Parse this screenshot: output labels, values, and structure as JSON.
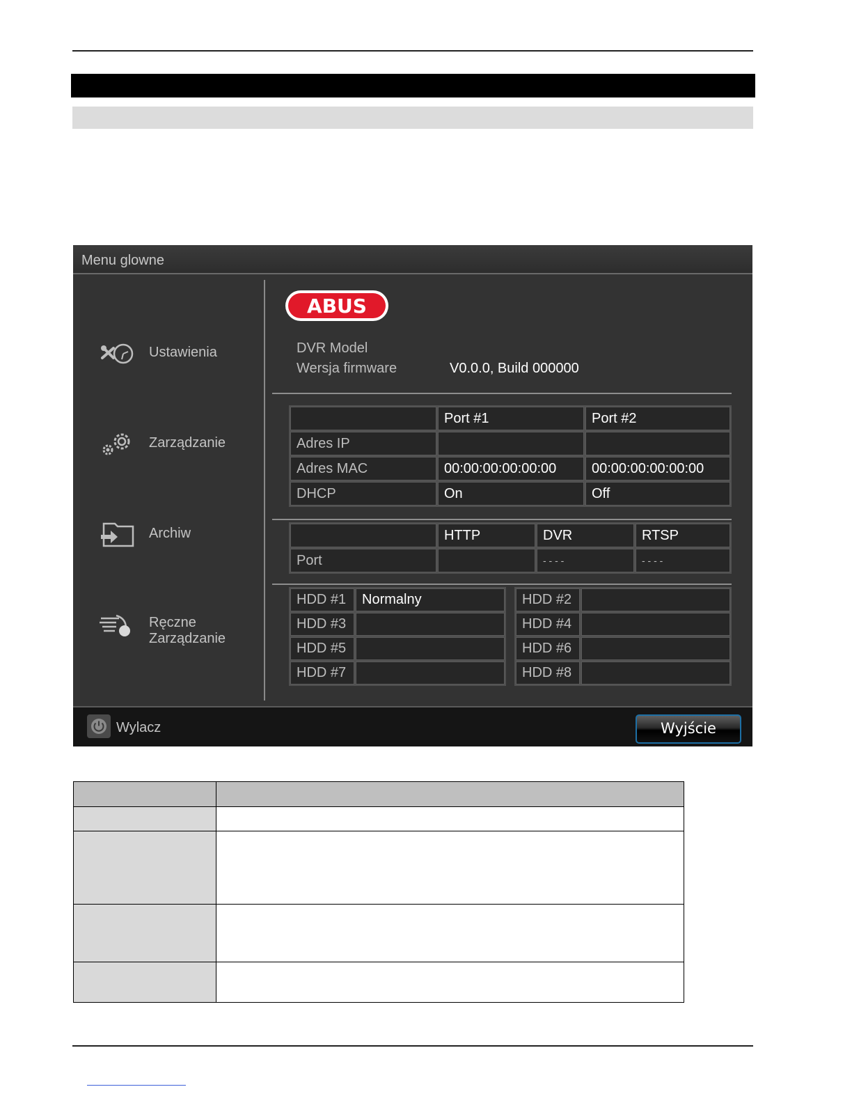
{
  "window": {
    "title": "Menu glowne"
  },
  "sidebar": {
    "items": [
      {
        "label": "Ustawienia",
        "icon": "tools-icon"
      },
      {
        "label": "Zarządzanie",
        "icon": "gears-icon"
      },
      {
        "label": "Archiw",
        "icon": "archive-icon"
      },
      {
        "label_line1": "Ręczne",
        "label_line2": "Zarządzanie",
        "icon": "manual-icon"
      }
    ]
  },
  "logo": {
    "text": "ABUS",
    "color": "#e1192a"
  },
  "info": {
    "model_label": "DVR Model",
    "firmware_label": "Wersja firmware",
    "firmware_value": "V0.0.0, Build 000000"
  },
  "network": {
    "headers": [
      "",
      "Port #1",
      "Port #2"
    ],
    "rows": [
      {
        "label": "Adres IP",
        "port1": "",
        "port2": ""
      },
      {
        "label": "Adres MAC",
        "port1": "00:00:00:00:00:00",
        "port2": "00:00:00:00:00:00"
      },
      {
        "label": "DHCP",
        "port1": "On",
        "port2": "Off"
      }
    ]
  },
  "ports": {
    "headers": [
      "",
      "HTTP",
      "DVR",
      "RTSP"
    ],
    "row_label": "Port",
    "http": "",
    "dvr": "- - - -",
    "rtsp": "- - - -"
  },
  "hdd": {
    "left": [
      {
        "label": "HDD #1",
        "status": "Normalny"
      },
      {
        "label": "HDD #3",
        "status": ""
      },
      {
        "label": "HDD #5",
        "status": ""
      },
      {
        "label": "HDD #7",
        "status": ""
      }
    ],
    "right": [
      {
        "label": "HDD #2",
        "status": ""
      },
      {
        "label": "HDD #4",
        "status": ""
      },
      {
        "label": "HDD #6",
        "status": ""
      },
      {
        "label": "HDD #8",
        "status": ""
      }
    ]
  },
  "footer": {
    "power_label": "Wylacz",
    "exit_label": "Wyjście",
    "exit_border_color": "#1d6fa5"
  }
}
